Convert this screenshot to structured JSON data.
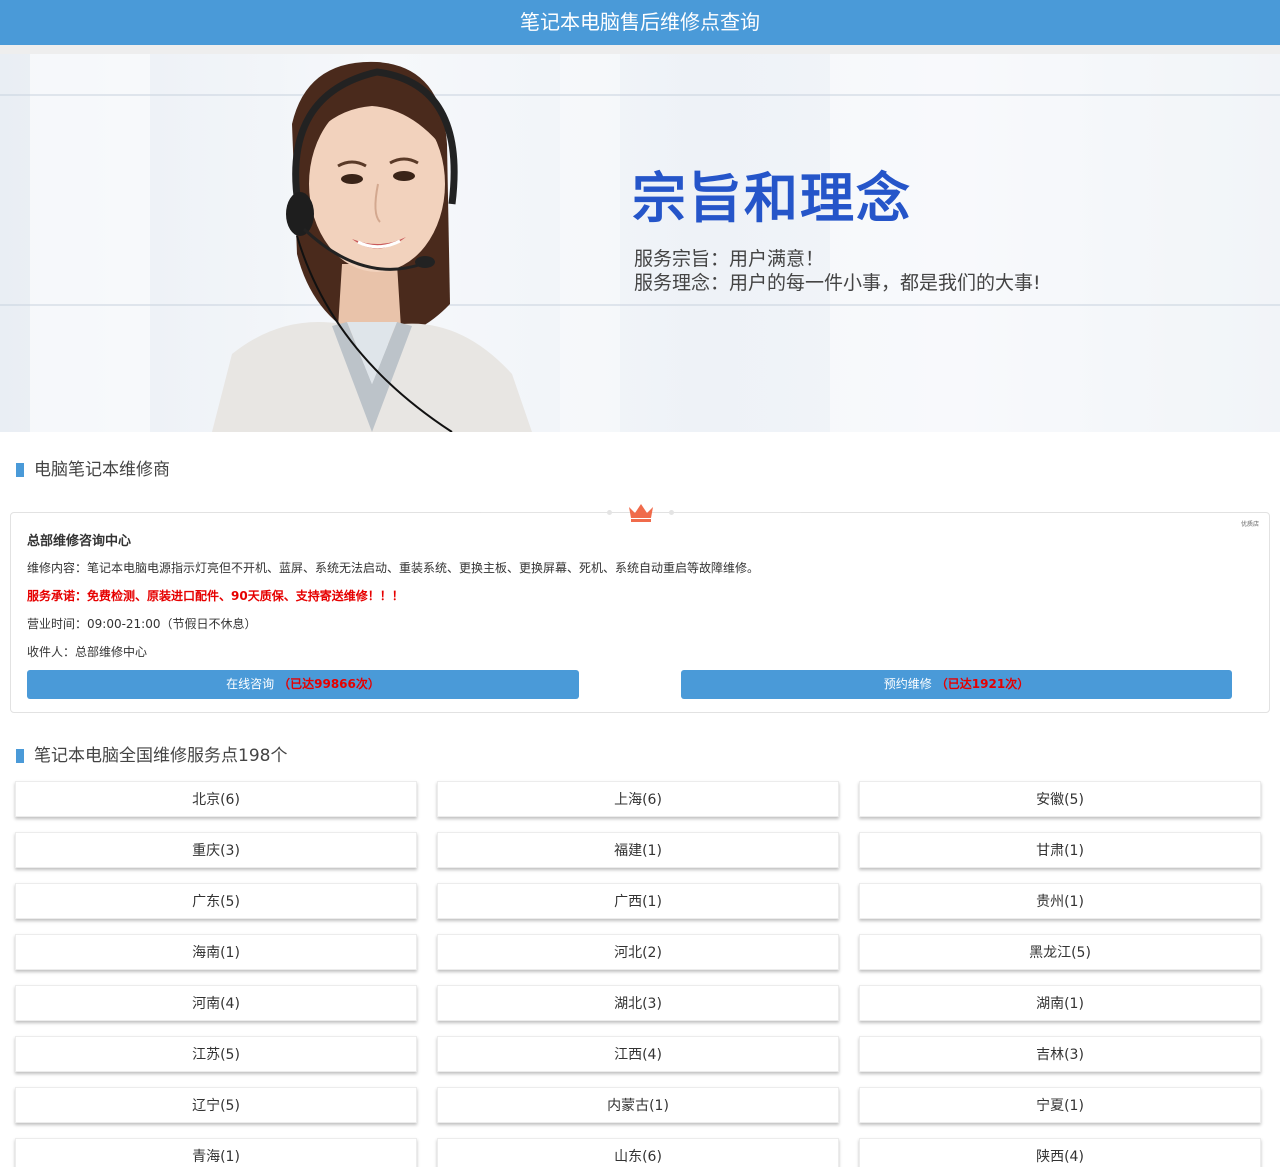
{
  "header": {
    "title": "笔记本电脑售后维修点查询"
  },
  "banner": {
    "heading": "宗旨和理念",
    "line1": "服务宗旨：用户满意！",
    "line2": "服务理念：用户的每一件小事，都是我们的大事!"
  },
  "repair_section": {
    "title": "电脑笔记本维修商",
    "card": {
      "tag": "优质店",
      "name": "总部维修咨询中心",
      "content": "维修内容：笔记本电脑电源指示灯亮但不开机、蓝屏、系统无法启动、重装系统、更换主板、更换屏幕、死机、系统自动重启等故障维修。",
      "promise": "服务承诺：免费检测、原装进口配件、90天质保、支持寄送维修！！！",
      "hours": "营业时间：09:00-21:00（节假日不休息）",
      "receiver": "收件人：总部维修中心",
      "consult_label": "在线咨询",
      "consult_count": "（已达99866次）",
      "booking_label": "预约维修",
      "booking_count": "（已达1921次）"
    }
  },
  "service_section": {
    "title": "笔记本电脑全国维修服务点198个",
    "provinces": [
      "北京(6)",
      "上海(6)",
      "安徽(5)",
      "重庆(3)",
      "福建(1)",
      "甘肃(1)",
      "广东(5)",
      "广西(1)",
      "贵州(1)",
      "海南(1)",
      "河北(2)",
      "黑龙江(5)",
      "河南(4)",
      "湖北(3)",
      "湖南(1)",
      "江苏(5)",
      "江西(4)",
      "吉林(3)",
      "辽宁(5)",
      "内蒙古(1)",
      "宁夏(1)",
      "青海(1)",
      "山东(6)",
      "陕西(4)"
    ]
  },
  "colors": {
    "accent": "#4a9ad8",
    "highlight": "#e60000",
    "banner_heading": "#2555c9"
  }
}
